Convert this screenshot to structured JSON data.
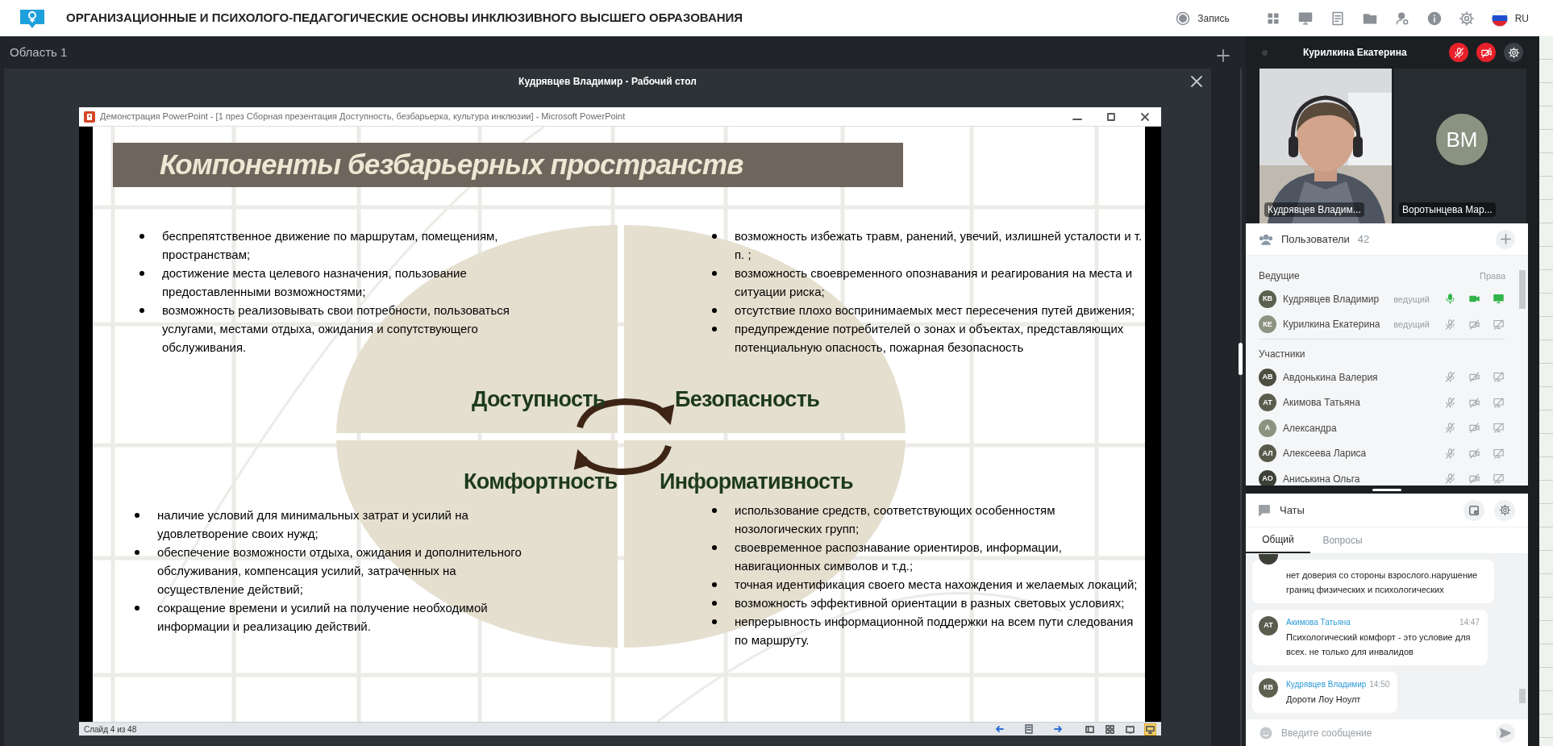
{
  "app_bar": {
    "title": "ОРГАНИЗАЦИОННЫЕ И ПСИХОЛОГО-ПЕДАГОГИЧЕСКИЕ ОСНОВЫ ИНКЛЮЗИВНОГО ВЫСШЕГО ОБРАЗОВАНИЯ",
    "record_label": "Запись",
    "language": "RU"
  },
  "area_label": "Область 1",
  "screen_share": {
    "title": "Кудрявцев Владимир - Рабочий стол",
    "ppt_window": {
      "title": "Демонстрация PowerPoint - [1 през Сборная презентация Доступность, безбарьерка, культура инклюзии] - Microsoft PowerPoint",
      "slide": {
        "title": "Компоненты безбарьерных пространств",
        "quadrants": [
          {
            "title": "Доступность",
            "items": [
              "беспрепятственное движение по маршрутам, помещениям, пространствам;",
              "достижение места целевого назначения, пользование предоставленными возможностями;",
              "возможность реализовывать свои потребности, пользоваться услугами, местами отдыха, ожидания и сопутствующего обслуживания."
            ]
          },
          {
            "title": "Безопасность",
            "items": [
              "возможность избежать травм, ранений, увечий, излишней усталости и т. п. ;",
              "возможность своевременного опознавания и реагирования на места и ситуации риска;",
              "отсутствие плохо воспринимаемых мест пересечения путей движения;",
              "предупреждение потребителей о зонах и объектах, представляющих потенциальную опасность, пожарная безопасность"
            ]
          },
          {
            "title": "Комфортность",
            "items": [
              "наличие условий для минимальных затрат и усилий на удовлетворение своих нужд;",
              "обеспечение возможности отдыха, ожидания и дополнительного обслуживания, компенсация усилий, затраченных на осуществление действий;",
              "сокращение времени и усилий на получение необходимой информации и реализацию действий."
            ]
          },
          {
            "title": "Информативность",
            "items": [
              "использование средств, соответствующих особенностям нозологических групп;",
              "своевременное распознавание ориентиров, информации, навигационных символов и т.д.;",
              "точная идентификация своего места нахождения и желаемых локаций;",
              "возможность эффективной ориентации в разных световых условиях;",
              "непрерывность информационной поддержки на всем пути следования по маршруту."
            ]
          }
        ]
      },
      "status": "Слайд 4 из 48",
      "views": [
        {
          "kind": "normal",
          "selected": false
        },
        {
          "kind": "sorter",
          "selected": false
        },
        {
          "kind": "reading",
          "selected": false
        },
        {
          "kind": "slideshow",
          "selected": true
        }
      ]
    }
  },
  "self_bar": {
    "name": "Курилкина Екатерина",
    "mic_muted": true,
    "camera_off": true
  },
  "video_tiles": [
    {
      "kind": "video",
      "name": "Кудрявцев Владим..."
    },
    {
      "kind": "avatar",
      "name": "Воротынцева Мар...",
      "initials": "ВМ"
    }
  ],
  "users": {
    "title": "Пользователи",
    "count": "42",
    "groups": [
      {
        "title": "Ведущие",
        "rights_label": "Права",
        "members": [
          {
            "initials": "КВ",
            "name": "Кудрявцев Владимир",
            "role": "ведущий",
            "color": "#5c604f",
            "mic_on": true,
            "camera_on": true,
            "screen_on": true
          },
          {
            "initials": "КЕ",
            "name": "Курилкина Екатерина",
            "role": "ведущий",
            "color": "#8d9281",
            "mic_on": false,
            "camera_on": false,
            "screen_on": false
          }
        ]
      },
      {
        "title": "Участники",
        "members": [
          {
            "initials": "АВ",
            "name": "Авдонькина Валерия",
            "color": "#4b4e41",
            "mic_on": false,
            "camera_on": false,
            "screen_on": false
          },
          {
            "initials": "АТ",
            "name": "Акимова Татьяна",
            "color": "#5a5d4e",
            "mic_on": false,
            "camera_on": false,
            "screen_on": false
          },
          {
            "initials": "А",
            "name": "Александра",
            "color": "#8a9380",
            "mic_on": false,
            "camera_on": false,
            "screen_on": false
          },
          {
            "initials": "АЛ",
            "name": "Алексеева Лариса",
            "color": "#585b4c",
            "mic_on": false,
            "camera_on": false,
            "screen_on": false
          },
          {
            "initials": "АО",
            "name": "Аниськина Ольга",
            "color": "#3d4036",
            "mic_on": false,
            "camera_on": false,
            "screen_on": false
          }
        ]
      }
    ]
  },
  "chat": {
    "title": "Чаты",
    "tabs": [
      {
        "label": "Общий",
        "selected": true
      },
      {
        "label": "Вопросы",
        "selected": false
      }
    ],
    "messages": [
      {
        "text": "нет доверия со стороны взрослого.нарушение границ физических и психологических",
        "color": "#3d4036"
      },
      {
        "initials": "АТ",
        "author": "Акимова Татьяна",
        "time": "14:47",
        "text": "Психологический комфорт - это условие для всех. не только для инвалидов",
        "color": "#5a5d4e"
      },
      {
        "initials": "КВ",
        "author": "Кудрявцев Владимир",
        "time": "14:50",
        "text": "Дороти Лоу Ноулт",
        "color": "#5c604f"
      }
    ],
    "placeholder": "Введите сообщение"
  }
}
